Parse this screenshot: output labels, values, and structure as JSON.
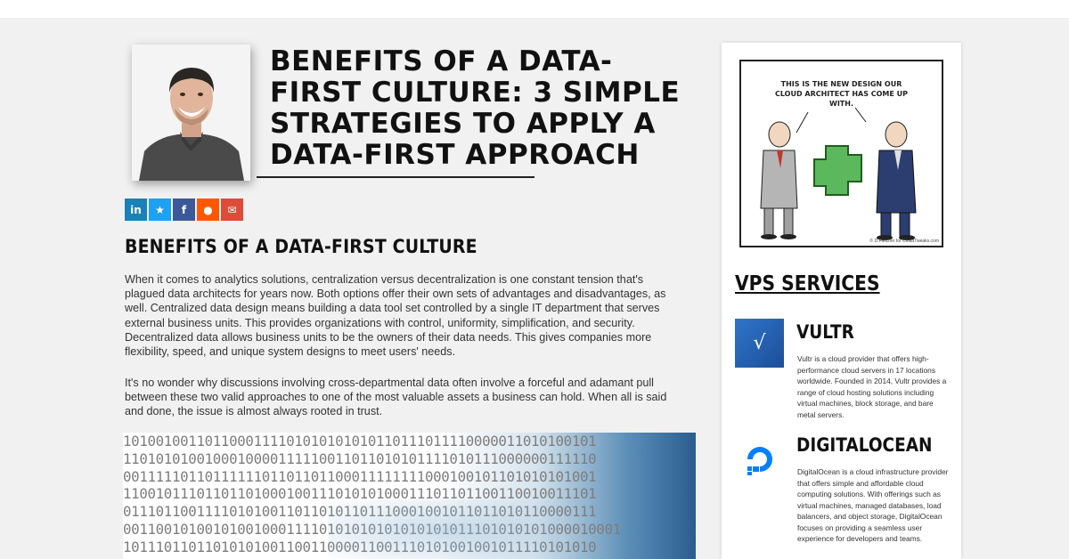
{
  "article": {
    "title": "BENEFITS OF A DATA-FIRST CULTURE: 3 SIMPLE STRATEGIES TO APPLY A DATA-FIRST APPROACH",
    "share_buttons": [
      {
        "name": "linkedin-share-button",
        "glyph": "in",
        "color": "#1a81b9"
      },
      {
        "name": "twitter-share-button",
        "glyph": "★",
        "color": "#1da1f2"
      },
      {
        "name": "facebook-share-button",
        "glyph": "f",
        "color": "#3b5998"
      },
      {
        "name": "reddit-share-button",
        "glyph": "●",
        "color": "#ff5700"
      },
      {
        "name": "email-share-button",
        "glyph": "✉",
        "color": "#dd4b39"
      }
    ],
    "section_heading": "BENEFITS OF A DATA-FIRST CULTURE",
    "paragraph_1": "When it comes to analytics solutions, centralization versus decentralization is one constant tension that's plagued data architects for years now. Both options offer their own sets of advantages and disadvantages, as well. Centralized data design means building a data tool set controlled by a single IT department that serves external business units. This provides organizations with control, uniformity, simplification, and security. Decentralized data allows business units to be the owners of their data needs. This gives companies more flexibility, speed, and unique system designs to meet users' needs.",
    "paragraph_2": "It's no wonder why discussions involving cross-departmental data often involve a forceful and adamant pull between these two valid approaches to one of the most valuable assets a business can hold. When all is said and done, the issue is almost always rooted in trust.",
    "binary_lines": [
      "1010010011011000111101010101010110111011110000011010100101",
      "1101010100100010000111110011011010101111010111000000111110",
      "0011111011011111101101101100011111111000100101101010101001",
      "1100101110110110100010011101010100011101101100110010011101",
      "0111011001111010100110110101101110001001011011010110000111",
      "0011001010010100100011110101010101010101011101010101000010001",
      "1011101101101010100110011000011001110101001001011110101010"
    ]
  },
  "sidebar": {
    "cartoon_caption": "THIS IS THE NEW DESIGN OUR CLOUD ARCHITECT HAS COME UP WITH.",
    "cartoon_credit": "© D.Fletcher for CloudTweaks.com",
    "section_title": "VPS SERVICES",
    "services": [
      {
        "name": "VULTR",
        "logo_glyph": "√",
        "description": "Vultr is a cloud provider that offers high-performance cloud servers in 17 locations worldwide. Founded in 2014, Vultr provides a range of cloud hosting solutions including virtual machines, block storage, and bare metal servers."
      },
      {
        "name": "DIGITALOCEAN",
        "description": "DigitalOcean is a cloud infrastructure provider that offers simple and affordable cloud computing solutions. With offerings such as virtual machines, managed databases, load balancers, and object storage, DigitalOcean focuses on providing a seamless user experience for developers and teams."
      }
    ]
  }
}
